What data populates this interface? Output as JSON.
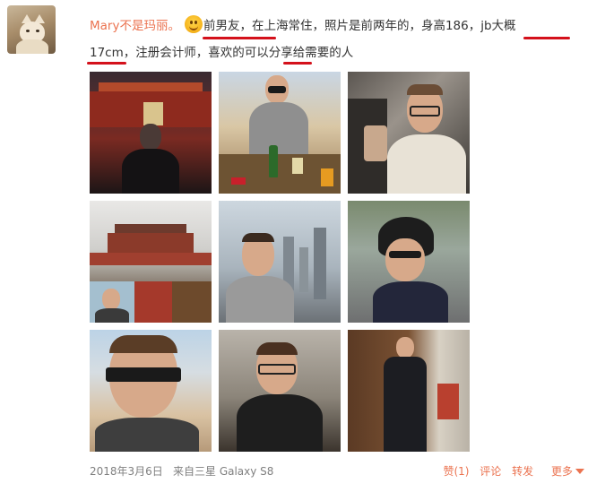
{
  "post": {
    "user": "Mary不是玛丽。",
    "line1": "前男友，在上海常住，照片是前两年的，身高186，jb大概",
    "line2": "17cm，注册会计师，喜欢的可以分享给需要的人",
    "emoji": "smile-emoji"
  },
  "photos": [
    {
      "name": "photo-tiananmen-night"
    },
    {
      "name": "photo-rooftop-bar"
    },
    {
      "name": "photo-airplane-seat"
    },
    {
      "name": "photo-forbidden-city-collage"
    },
    {
      "name": "photo-skyline-selfie"
    },
    {
      "name": "photo-helmet-selfie"
    },
    {
      "name": "photo-beach-sunglasses"
    },
    {
      "name": "photo-cabin-selfie"
    },
    {
      "name": "photo-suit-hallway"
    }
  ],
  "footer": {
    "time": "2018年3月6日",
    "source": "来自三星 Galaxy S8",
    "like": "赞(1)",
    "comment": "评论",
    "repost": "转发",
    "more": "更多"
  }
}
